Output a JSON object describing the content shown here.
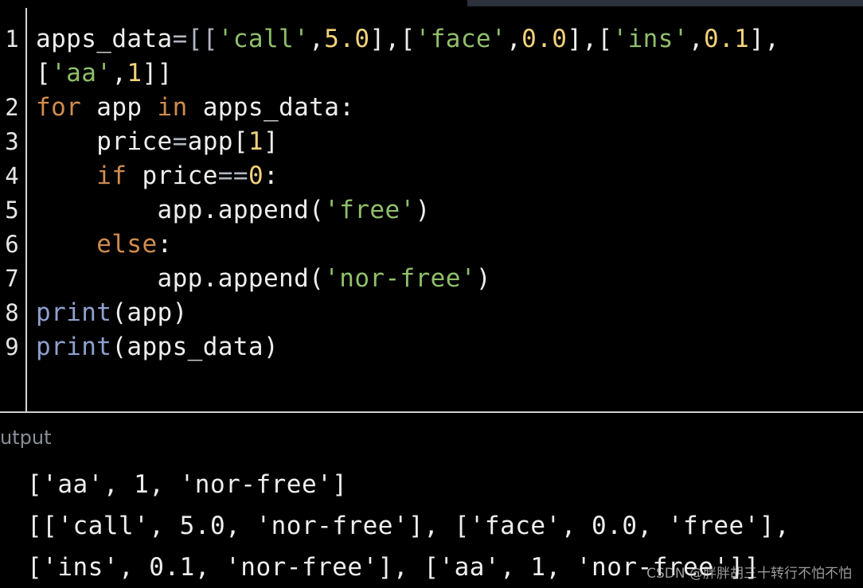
{
  "editor": {
    "line_numbers": [
      "1",
      "2",
      "3",
      "4",
      "5",
      "6",
      "7",
      "8",
      "9"
    ],
    "line1": {
      "t1": "apps_data",
      "t2": "=[[",
      "t3": "'call'",
      "t4": ",",
      "t5": "5.0",
      "t6": "],[",
      "t7": "'face'",
      "t8": ",",
      "t9": "0.0",
      "t10": "],[",
      "t11": "'ins'",
      "t12": ",",
      "t13": "0.1",
      "t14": "],"
    },
    "line1_wrap": {
      "t1": "[",
      "t2": "'aa'",
      "t3": ",",
      "t4": "1",
      "t5": "]]"
    },
    "line2": {
      "t1": "for",
      "t2": " app ",
      "t3": "in",
      "t4": " apps_data:"
    },
    "line3": {
      "t1": "    price",
      "t2": "=",
      "t3": "app[",
      "t4": "1",
      "t5": "]"
    },
    "line4": {
      "t1": "    ",
      "t2": "if",
      "t3": " price",
      "t4": "==",
      "t5": "0",
      "t6": ":"
    },
    "line5": {
      "t1": "        app.append(",
      "t2": "'free'",
      "t3": ")"
    },
    "line6": {
      "t1": "    ",
      "t2": "else",
      "t3": ":"
    },
    "line7": {
      "t1": "        app.append(",
      "t2": "'nor-free'",
      "t3": ")"
    },
    "line8": {
      "t1": "print",
      "t2": "(app)"
    },
    "line9": {
      "t1": "print",
      "t2": "(apps_data)"
    }
  },
  "output": {
    "label": "utput",
    "lines": [
      "['aa', 1, 'nor-free']",
      "[['call', 5.0, 'nor-free'], ['face', 0.0, 'free'],",
      "['ins', 0.1, 'nor-free'], ['aa', 1, 'nor-free']]"
    ]
  },
  "watermark": "CSDN @胖胖胡三十转行不怕不怕",
  "colors": {
    "background": "#000000",
    "string": "#8fbf6a",
    "number": "#f3d27a",
    "keyword": "#d08c4e",
    "builtin": "#8fa0cf"
  }
}
